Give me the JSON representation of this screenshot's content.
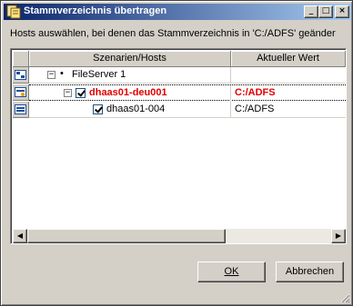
{
  "window": {
    "title": "Stammverzeichnis übertragen",
    "controls": {
      "minimize": "_",
      "maximize": "□",
      "close": "×"
    }
  },
  "instruction": "Hosts auswählen, bei denen das Stammverzeichnis in 'C:/ADFS' geänder",
  "grid": {
    "columns": [
      "Szenarien/Hosts",
      "Aktueller Wert"
    ],
    "rows": [
      {
        "name": "FileServer 1",
        "value": "",
        "expander": "−",
        "checked": false,
        "highlight": false,
        "icon": "server-group-icon"
      },
      {
        "name": "dhaas01-deu001",
        "value": "C:/ADFS",
        "expander": "−",
        "checked": true,
        "highlight": true,
        "icon": "master-server-icon"
      },
      {
        "name": "dhaas01-004",
        "value": "C:/ADFS",
        "expander": "",
        "checked": true,
        "highlight": false,
        "icon": "replica-server-icon"
      }
    ]
  },
  "scrollbar": {
    "left_arrow": "◀",
    "right_arrow": "▶"
  },
  "buttons": {
    "ok": "OK",
    "cancel": "Abbrechen"
  },
  "colors": {
    "highlight": "#e00000",
    "titlebar_start": "#0a246a",
    "titlebar_end": "#a6caf0"
  }
}
